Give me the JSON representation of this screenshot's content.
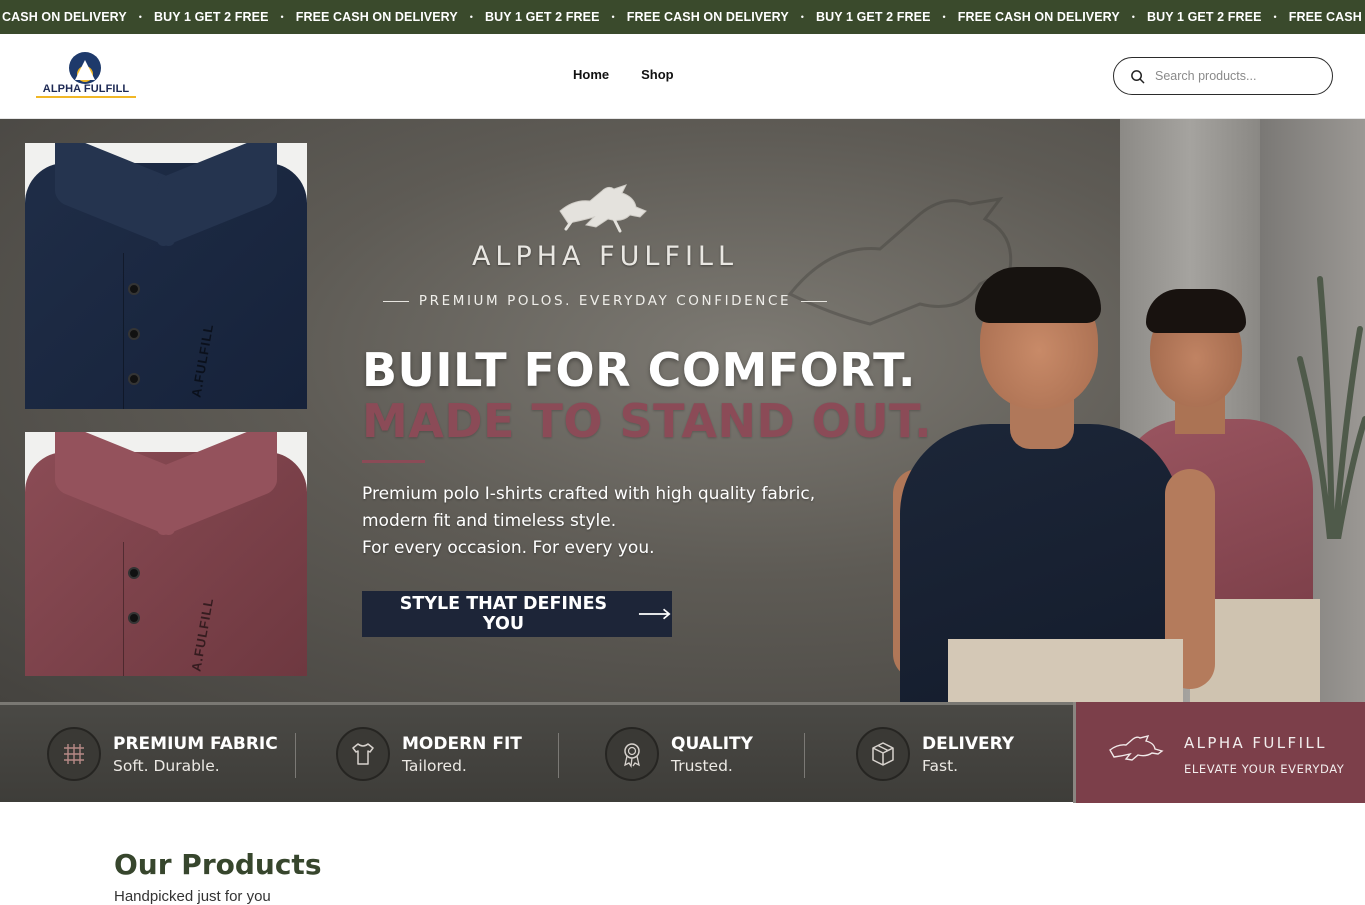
{
  "announcement": {
    "items": [
      "E CASH ON DELIVERY",
      "BUY 1 GET 2 FREE",
      "FREE CASH ON DELIVERY",
      "BUY 1 GET 2 FREE",
      "FREE CASH ON DELIVERY",
      "BUY 1 GET 2 FREE",
      "FREE CASH ON DELIVERY",
      "BUY 1 GET 2 FREE",
      "FREE CASH ON DELIVER"
    ],
    "separator": "•",
    "background": "#3a4a2c"
  },
  "header": {
    "logo_text": "ALPHA FULFILL",
    "nav": [
      "Home",
      "Shop"
    ],
    "search_placeholder": "Search products..."
  },
  "hero": {
    "thumb_brand": "A.FULFILL",
    "brand_name": "ALPHA FULFILL",
    "brand_tagline": "PREMIUM POLOS. EVERYDAY CONFIDENCE",
    "headline_1": "BUILT FOR COMFORT.",
    "headline_2": "MADE TO STAND OUT.",
    "copy_lines": [
      "Premium polo I-shirts crafted with high quality fabric,",
      "modern fit and timeless style.",
      "For every occasion. For every you."
    ],
    "cta_label": "STYLE THAT DEFINES YOU",
    "accent_color": "#8b4b57"
  },
  "features": [
    {
      "title": "PREMIUM FABRIC",
      "sub": "Soft. Durable.",
      "icon": "fabric-grid-icon"
    },
    {
      "title": "MODERN FIT",
      "sub": "Tailored.",
      "icon": "tshirt-icon"
    },
    {
      "title": "QUALITY",
      "sub": "Trusted.",
      "icon": "badge-icon"
    },
    {
      "title": "DELIVERY",
      "sub": "Fast.",
      "icon": "box-icon"
    }
  ],
  "brand_card": {
    "name": "ALPHA FULFILL",
    "tagline": "ELEVATE YOUR EVERYDAY",
    "background": "#7c3f4a"
  },
  "products": {
    "title": "Our Products",
    "subtitle": "Handpicked just for you"
  }
}
